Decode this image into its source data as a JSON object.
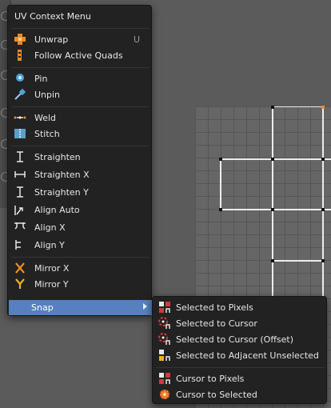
{
  "menu": {
    "title": "UV Context Menu",
    "unwrap": {
      "label": "Unwrap",
      "shortcut": "U"
    },
    "follow_active_quads": {
      "label": "Follow Active Quads"
    },
    "pin": {
      "label": "Pin"
    },
    "unpin": {
      "label": "Unpin"
    },
    "weld": {
      "label": "Weld"
    },
    "stitch": {
      "label": "Stitch"
    },
    "straighten": {
      "label": "Straighten"
    },
    "straighten_x": {
      "label": "Straighten X"
    },
    "straighten_y": {
      "label": "Straighten Y"
    },
    "align_auto": {
      "label": "Align Auto"
    },
    "align_x": {
      "label": "Align X"
    },
    "align_y": {
      "label": "Align Y"
    },
    "mirror_x": {
      "label": "Mirror X"
    },
    "mirror_y": {
      "label": "Mirror Y"
    },
    "snap": {
      "label": "Snap"
    }
  },
  "snap_menu": {
    "selected_to_pixels": "Selected to Pixels",
    "selected_to_cursor": "Selected to Cursor",
    "selected_to_cursor_offset": "Selected to Cursor (Offset)",
    "selected_to_adjacent_unselected": "Selected to Adjacent Unselected",
    "cursor_to_pixels": "Cursor to Pixels",
    "cursor_to_selected": "Cursor to Selected"
  },
  "colors": {
    "menu_bg": "#222222",
    "highlight": "#5680c2",
    "accent_orange": "#f08a24",
    "selected_edge": "#f08a24"
  },
  "icons": {
    "unwrap": "unwrap-icon",
    "follow_active_quads": "follow-quads-icon",
    "pin": "pin-icon",
    "unpin": "unpin-icon",
    "weld": "weld-icon",
    "stitch": "stitch-icon",
    "straighten": "straighten-icon",
    "align": "align-icon",
    "mirror_x": "mirror-x-icon",
    "mirror_y": "mirror-y-icon",
    "snap": "snap-icon"
  }
}
